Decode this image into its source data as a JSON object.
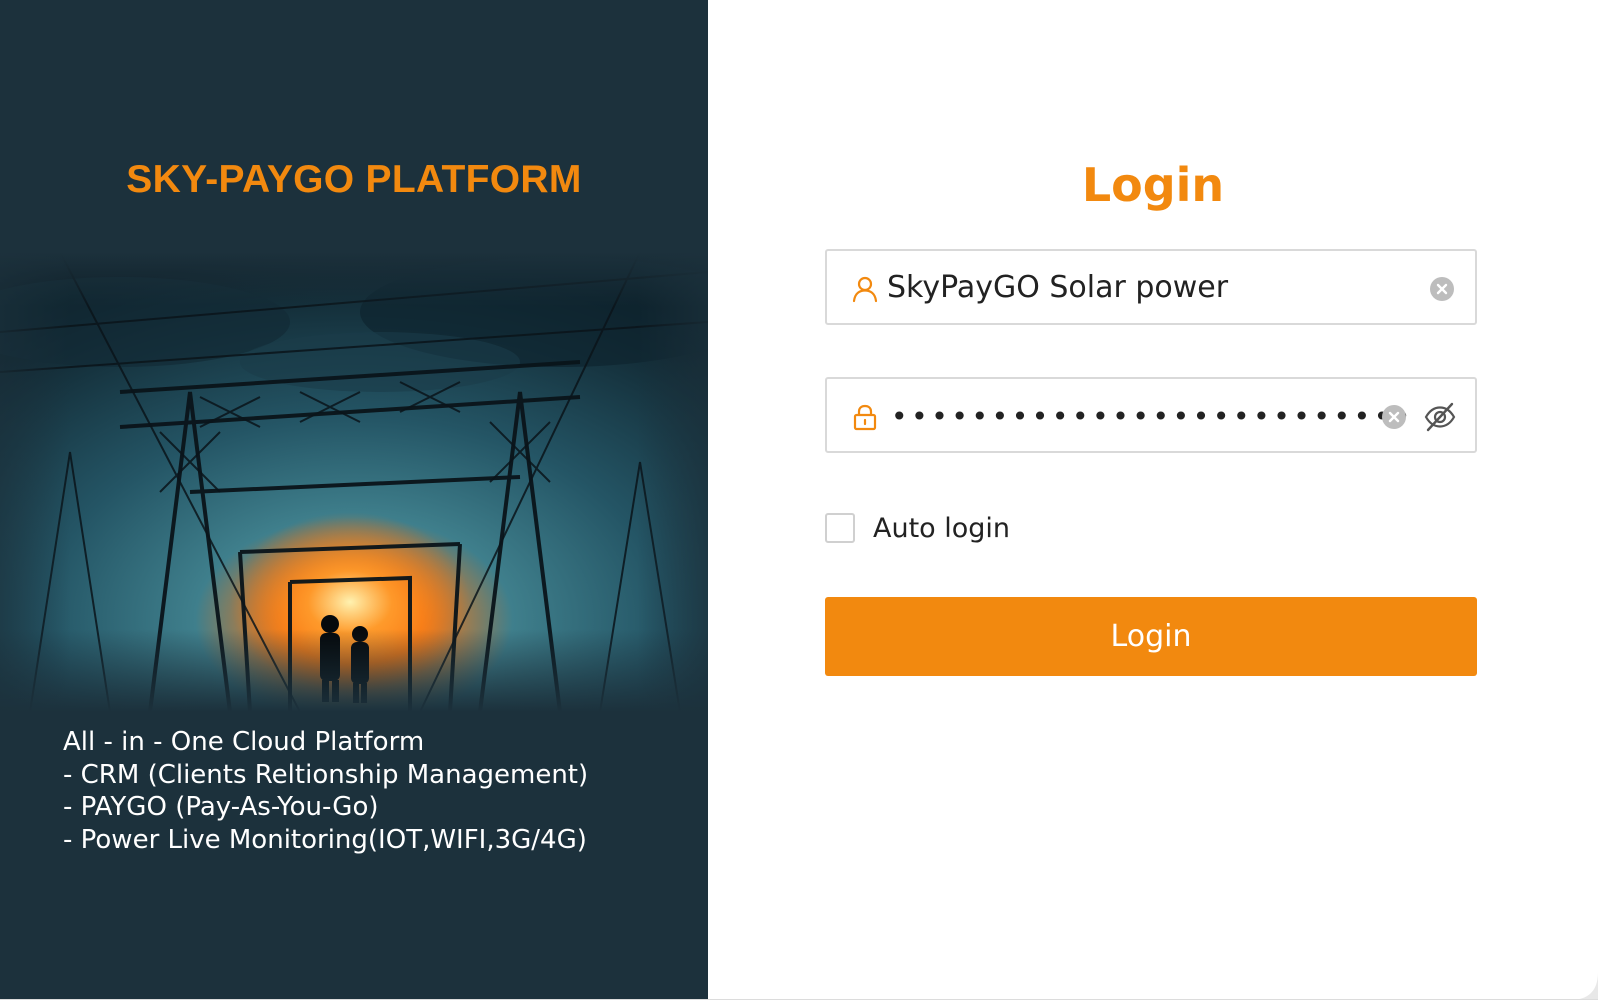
{
  "left_panel": {
    "title": "SKY-PAYGO PLATFORM",
    "features": [
      "All - in - One Cloud Platform",
      "- CRM (Clients Reltionship Management)",
      "- PAYGO (Pay-As-You-Go)",
      "- Power Live Monitoring(IOT,WIFI,3G/4G)"
    ],
    "hero_image": "power-substation-towers-sunset-illustration"
  },
  "login_form": {
    "title": "Login",
    "username": {
      "value": "SkyPayGO Solar power",
      "icon": "user-icon",
      "clear_icon": "clear-circle-icon"
    },
    "password": {
      "masked_value": "••••••••••••••••••••••••••",
      "icon": "lock-icon",
      "clear_icon": "clear-circle-icon",
      "toggle_icon": "eye-slash-icon"
    },
    "auto_login": {
      "label": "Auto login",
      "checked": false
    },
    "submit_label": "Login"
  },
  "colors": {
    "accent": "#f2890f",
    "panel_bg": "#1c313c",
    "border": "#d9d9d9"
  }
}
